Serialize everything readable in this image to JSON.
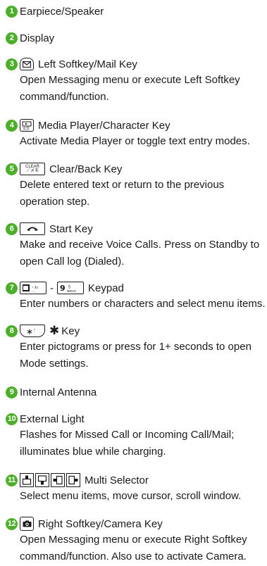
{
  "items": [
    {
      "num": "1",
      "title": "Earpiece/Speaker"
    },
    {
      "num": "2",
      "title": "Display"
    },
    {
      "num": "3",
      "title": "Left Softkey/Mail Key",
      "icon": "mail-key-icon",
      "desc": [
        "Open Messaging menu or execute Left Softkey",
        "command/function."
      ]
    },
    {
      "num": "4",
      "title": "Media Player/Character Key",
      "icon": "media-character-key-icon",
      "desc": [
        "Activate Media Player or toggle text entry modes."
      ]
    },
    {
      "num": "5",
      "title": "Clear/Back Key",
      "icon": "clear-key-icon",
      "key_text": "CLEAR ／メモ",
      "desc": [
        "Delete entered text or return to the previous",
        "operation step."
      ]
    },
    {
      "num": "6",
      "title": "Start Key",
      "icon": "start-key-icon",
      "desc": [
        "Make and receive Voice Calls. Press on Standby to",
        "open Call log (Dialed)."
      ]
    },
    {
      "num": "7",
      "title": "Keypad",
      "separator": "-",
      "icon": "keypad-0-9-icons",
      "desc": [
        "Enter numbers or characters and select menu items."
      ]
    },
    {
      "num": "8",
      "title": "Key",
      "symbol": "✱",
      "icon": "asterisk-key-icon",
      "desc": [
        "Enter pictograms or press for 1+ seconds to open",
        "Mode settings."
      ]
    },
    {
      "num": "9",
      "title": "Internal Antenna"
    },
    {
      "num": "10",
      "title": "External Light",
      "desc": [
        "Flashes for Missed Call or Incoming Call/Mail;",
        "illuminates blue while charging."
      ]
    },
    {
      "num": "11",
      "title": "Multi Selector",
      "icon": "multi-selector-icons",
      "desc": [
        "Select menu items, move cursor, scroll window."
      ]
    },
    {
      "num": "12",
      "title": "Right Softkey/Camera Key",
      "icon": "camera-key-icon",
      "desc": [
        "Open Messaging menu or execute Right Softkey",
        "command/function. Also use to activate Camera."
      ]
    }
  ],
  "colors": {
    "badge": "#4caf2a",
    "text": "#1a1a1a"
  }
}
